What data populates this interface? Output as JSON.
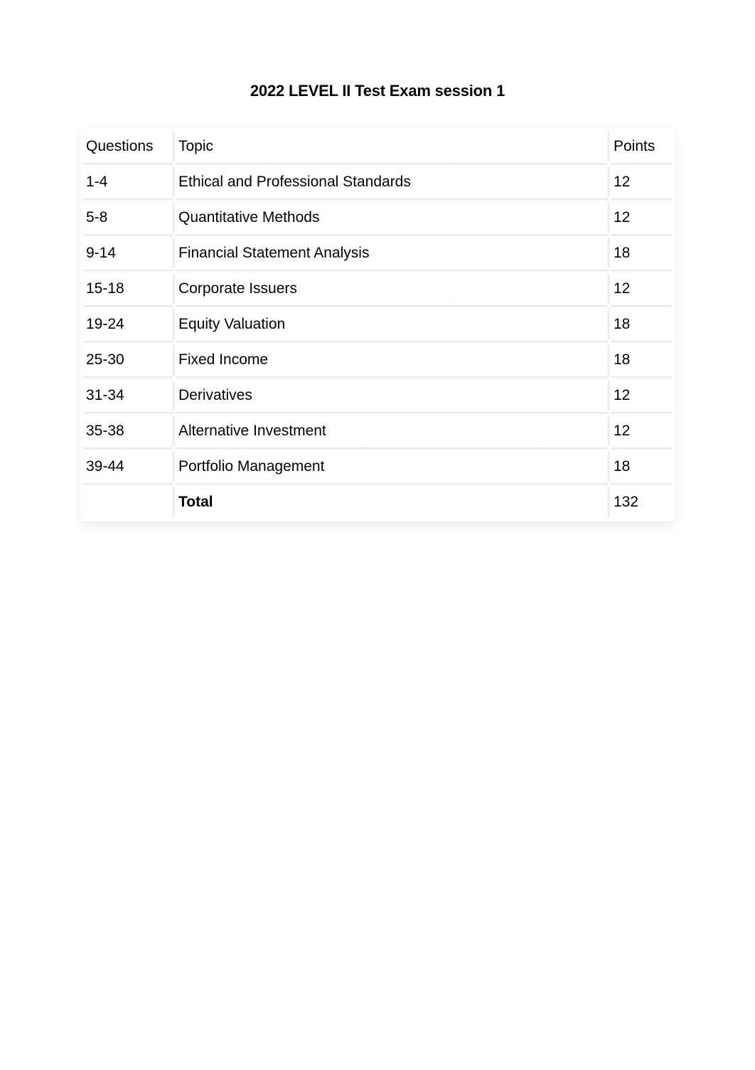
{
  "title": "2022 LEVEL II Test Exam session 1",
  "headers": {
    "questions": "Questions",
    "topic": "Topic",
    "points": "Points"
  },
  "rows": [
    {
      "questions": "1-4",
      "topic": "Ethical and Professional Standards",
      "points": "12"
    },
    {
      "questions": "5-8",
      "topic": "Quantitative Methods",
      "points": "12"
    },
    {
      "questions": "9-14",
      "topic": "Financial Statement Analysis",
      "points": "18"
    },
    {
      "questions": "15-18",
      "topic": "Corporate Issuers",
      "points": "12"
    },
    {
      "questions": "19-24",
      "topic": "Equity Valuation",
      "points": "18"
    },
    {
      "questions": "25-30",
      "topic": "Fixed Income",
      "points": "18"
    },
    {
      "questions": "31-34",
      "topic": "Derivatives",
      "points": "12"
    },
    {
      "questions": "35-38",
      "topic": "Alternative Investment",
      "points": "12"
    },
    {
      "questions": "39-44",
      "topic": "Portfolio Management",
      "points": "18"
    }
  ],
  "total": {
    "questions": "",
    "label": "Total",
    "points": "132"
  }
}
